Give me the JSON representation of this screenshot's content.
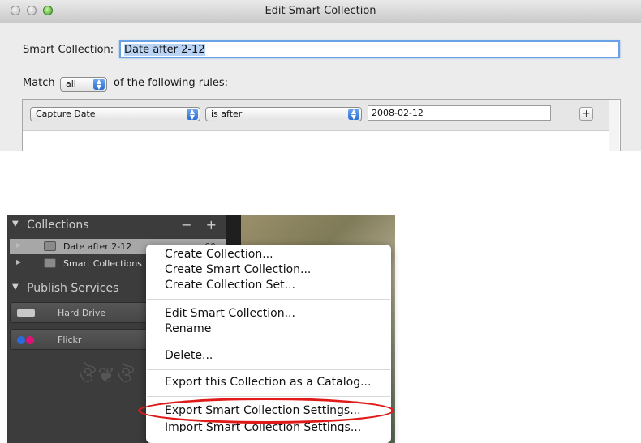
{
  "dialog": {
    "title": "Edit Smart Collection",
    "name_label": "Smart Collection:",
    "name_value": "Date after 2-12",
    "match_label": "Match",
    "match_value": "all",
    "match_suffix": "of the following rules:",
    "rule": {
      "field": "Capture Date",
      "operator": "is after",
      "value": "2008-02-12",
      "add_button": "+"
    }
  },
  "panel": {
    "collections_header": "Collections",
    "collections_tools": "− +",
    "collections": [
      {
        "label": "Date after 2-12",
        "count": "60",
        "selected": true
      },
      {
        "label": "Smart Collections"
      }
    ],
    "publish_header": "Publish Services",
    "publish_services": [
      {
        "label": "Hard Drive"
      },
      {
        "label": "Flickr"
      }
    ],
    "ornament": "ঔ❦ঔ"
  },
  "context_menu": {
    "items": [
      "Create Collection...",
      "Create Smart Collection...",
      "Create Collection Set...",
      "Edit Smart Collection...",
      "Rename",
      "Delete...",
      "Export this Collection as a Catalog...",
      "Export Smart Collection Settings...",
      "Import Smart Collection Settings..."
    ],
    "highlighted": "Export Smart Collection Settings..."
  },
  "colors": {
    "highlight_ellipse": "#e01919",
    "input_focus": "#6aa0e6",
    "popup_arrow": "#2c6fd4"
  }
}
